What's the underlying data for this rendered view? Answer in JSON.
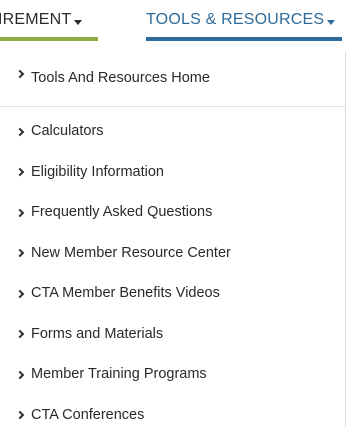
{
  "nav": {
    "tabs": [
      {
        "label": "IREMENT"
      },
      {
        "label": "TOOLS & RESOURCES"
      }
    ],
    "colors": {
      "retirement_underline": "#8cb043",
      "tools_active": "#2e6b9a"
    }
  },
  "menu": {
    "home_label": "Tools And Resources Home",
    "items": [
      {
        "label": "Calculators"
      },
      {
        "label": "Eligibility Information"
      },
      {
        "label": "Frequently Asked Questions"
      },
      {
        "label": "New Member Resource Center"
      },
      {
        "label": "CTA Member Benefits Videos"
      },
      {
        "label": "Forms and Materials"
      },
      {
        "label": "Member Training Programs"
      },
      {
        "label": "CTA Conferences"
      }
    ],
    "chevron_icon": "chevron-right-icon"
  }
}
